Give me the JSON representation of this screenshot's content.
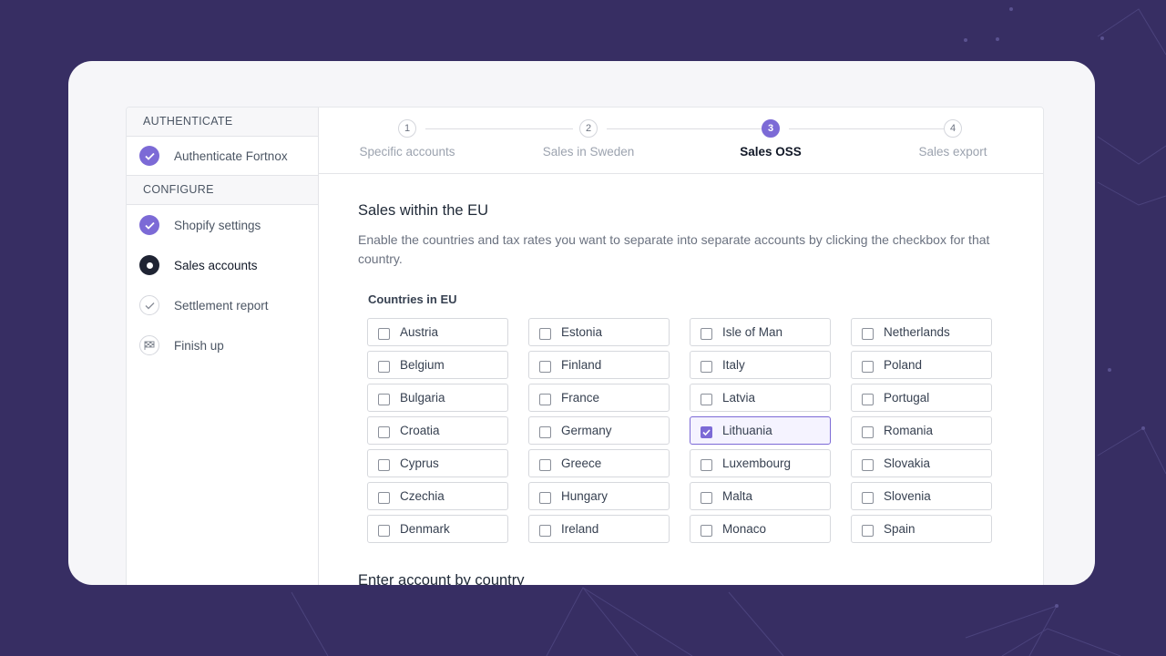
{
  "colors": {
    "background": "#372e63",
    "accent": "#7c6ad6",
    "dark": "#1f2433"
  },
  "sidebar": {
    "sections": [
      {
        "header": "AUTHENTICATE",
        "items": [
          {
            "label": "Authenticate Fortnox",
            "status": "done",
            "icon": "check-icon"
          }
        ]
      },
      {
        "header": "CONFIGURE",
        "items": [
          {
            "label": "Shopify settings",
            "status": "done",
            "icon": "check-icon"
          },
          {
            "label": "Sales accounts",
            "status": "current",
            "icon": "current-dot-icon"
          },
          {
            "label": "Settlement report",
            "status": "pending",
            "icon": "check-outline-icon"
          },
          {
            "label": "Finish up",
            "status": "pending",
            "icon": "flag-icon"
          }
        ]
      }
    ]
  },
  "stepper": {
    "steps": [
      {
        "number": "1",
        "label": "Specific accounts"
      },
      {
        "number": "2",
        "label": "Sales in Sweden"
      },
      {
        "number": "3",
        "label": "Sales OSS",
        "active": true
      },
      {
        "number": "4",
        "label": "Sales export"
      }
    ]
  },
  "main": {
    "title": "Sales within the EU",
    "description": "Enable the countries and tax rates you want to separate into separate accounts by clicking the checkbox for that country.",
    "countries_label": "Countries in EU",
    "countries": [
      {
        "name": "Austria",
        "checked": false
      },
      {
        "name": "Estonia",
        "checked": false
      },
      {
        "name": "Isle of Man",
        "checked": false
      },
      {
        "name": "Netherlands",
        "checked": false
      },
      {
        "name": "Belgium",
        "checked": false
      },
      {
        "name": "Finland",
        "checked": false
      },
      {
        "name": "Italy",
        "checked": false
      },
      {
        "name": "Poland",
        "checked": false
      },
      {
        "name": "Bulgaria",
        "checked": false
      },
      {
        "name": "France",
        "checked": false
      },
      {
        "name": "Latvia",
        "checked": false
      },
      {
        "name": "Portugal",
        "checked": false
      },
      {
        "name": "Croatia",
        "checked": false
      },
      {
        "name": "Germany",
        "checked": false
      },
      {
        "name": "Lithuania",
        "checked": true
      },
      {
        "name": "Romania",
        "checked": false
      },
      {
        "name": "Cyprus",
        "checked": false
      },
      {
        "name": "Greece",
        "checked": false
      },
      {
        "name": "Luxembourg",
        "checked": false
      },
      {
        "name": "Slovakia",
        "checked": false
      },
      {
        "name": "Czechia",
        "checked": false
      },
      {
        "name": "Hungary",
        "checked": false
      },
      {
        "name": "Malta",
        "checked": false
      },
      {
        "name": "Slovenia",
        "checked": false
      },
      {
        "name": "Denmark",
        "checked": false
      },
      {
        "name": "Ireland",
        "checked": false
      },
      {
        "name": "Monaco",
        "checked": false
      },
      {
        "name": "Spain",
        "checked": false
      }
    ],
    "second_title": "Enter account by country"
  }
}
